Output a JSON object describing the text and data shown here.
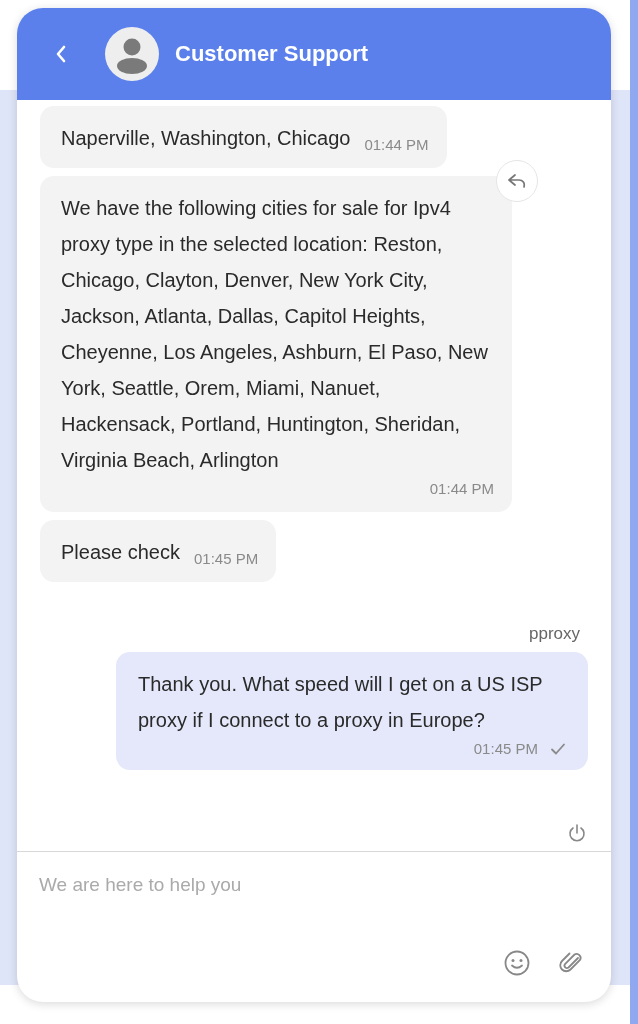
{
  "header": {
    "title": "Customer Support"
  },
  "messages": [
    {
      "kind": "incoming",
      "text": "Naperville, Washington, Chicago",
      "time": "01:44 PM",
      "show_reply": false
    },
    {
      "kind": "incoming",
      "text": "We have the following cities for sale for Ipv4 proxy type in the selected location: Reston, Chicago, Clayton, Denver, New York City, Jackson, Atlanta, Dallas, Capitol Heights, Cheyenne, Los Angeles, Ashburn, El Paso, New York, Seattle, Orem, Miami, Nanuet, Hackensack, Portland, Huntington, Sheridan, Virginia Beach, Arlington",
      "time": "01:44 PM",
      "show_reply": true
    },
    {
      "kind": "incoming",
      "text": "Please check",
      "time": "01:45 PM",
      "show_reply": false
    },
    {
      "kind": "outgoing",
      "sender": "pproxy",
      "text": "Thank you. What speed will I get on a US ISP proxy if I connect to a proxy in Europe?",
      "time": "01:45 PM",
      "read": true,
      "show_reply": false
    }
  ],
  "composer": {
    "placeholder": "We are here to help you"
  }
}
